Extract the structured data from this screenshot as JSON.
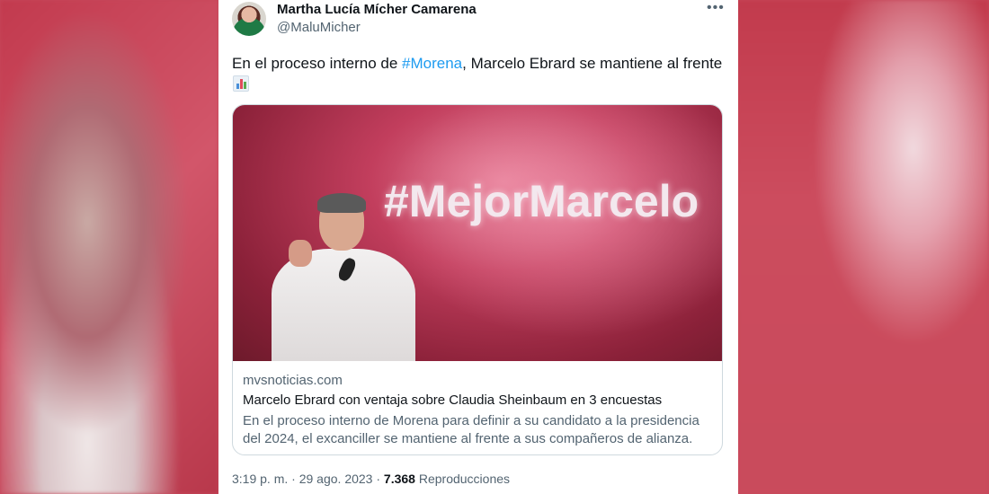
{
  "tweet": {
    "author_name": "Martha Lucía Mícher Camarena",
    "author_handle": "@MaluMicher",
    "more_icon": "more-horizontal-icon",
    "text_before": "En el proceso interno de ",
    "hashtag": "#Morena",
    "text_after": ", Marcelo Ebrard se mantiene al frente",
    "emoji_icon": "bar-chart-icon",
    "time": "3:19 p. m.",
    "sep1": " · ",
    "date": "29 ago. 2023",
    "sep2": " · ",
    "views_count": "7.368",
    "views_label": " Reproducciones"
  },
  "link_card": {
    "image_banner_text": "#MejorMarcelo",
    "domain": "mvsnoticias.com",
    "title": "Marcelo Ebrard con ventaja sobre Claudia Sheinbaum en 3 encuestas",
    "description": "En el proceso interno de Morena para definir a su candidato a la presidencia del 2024, el excanciller se mantiene al frente a sus compañeros de alianza."
  },
  "colors": {
    "hashtag": "#1d9bf0",
    "text": "#0f1419",
    "secondary": "#536471",
    "background": "#c7475a"
  }
}
